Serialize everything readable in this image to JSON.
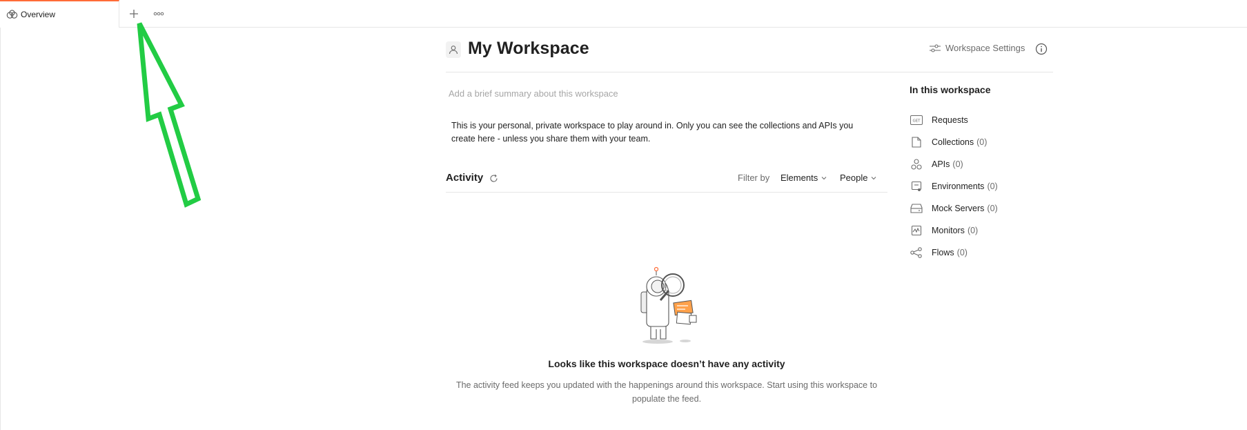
{
  "tabbar": {
    "tab_label": "Overview"
  },
  "header": {
    "title": "My Workspace",
    "settings_label": "Workspace Settings"
  },
  "summary_placeholder": "Add a brief summary about this workspace",
  "description": "This is your personal, private workspace to play around in. Only you can see the collections and APIs you create here - unless you share them with your team.",
  "activity": {
    "title": "Activity",
    "filter_label": "Filter by",
    "filters": [
      "Elements",
      "People"
    ]
  },
  "empty_state": {
    "title": "Looks like this workspace doesn’t have any activity",
    "text": "The activity feed keeps you updated with the happenings around this workspace. Start using this workspace to populate the feed."
  },
  "sidebar": {
    "title": "In this workspace",
    "items": [
      {
        "label": "Requests",
        "count": "",
        "icon": "get-request-icon"
      },
      {
        "label": "Collections",
        "count": "(0)",
        "icon": "collection-icon"
      },
      {
        "label": "APIs",
        "count": "(0)",
        "icon": "api-icon"
      },
      {
        "label": "Environments",
        "count": "(0)",
        "icon": "environment-icon"
      },
      {
        "label": "Mock Servers",
        "count": "(0)",
        "icon": "mock-server-icon"
      },
      {
        "label": "Monitors",
        "count": "(0)",
        "icon": "monitor-icon"
      },
      {
        "label": "Flows",
        "count": "(0)",
        "icon": "flows-icon"
      }
    ]
  },
  "colors": {
    "accent": "#ff6c37",
    "annotation_arrow": "#22cc44"
  }
}
